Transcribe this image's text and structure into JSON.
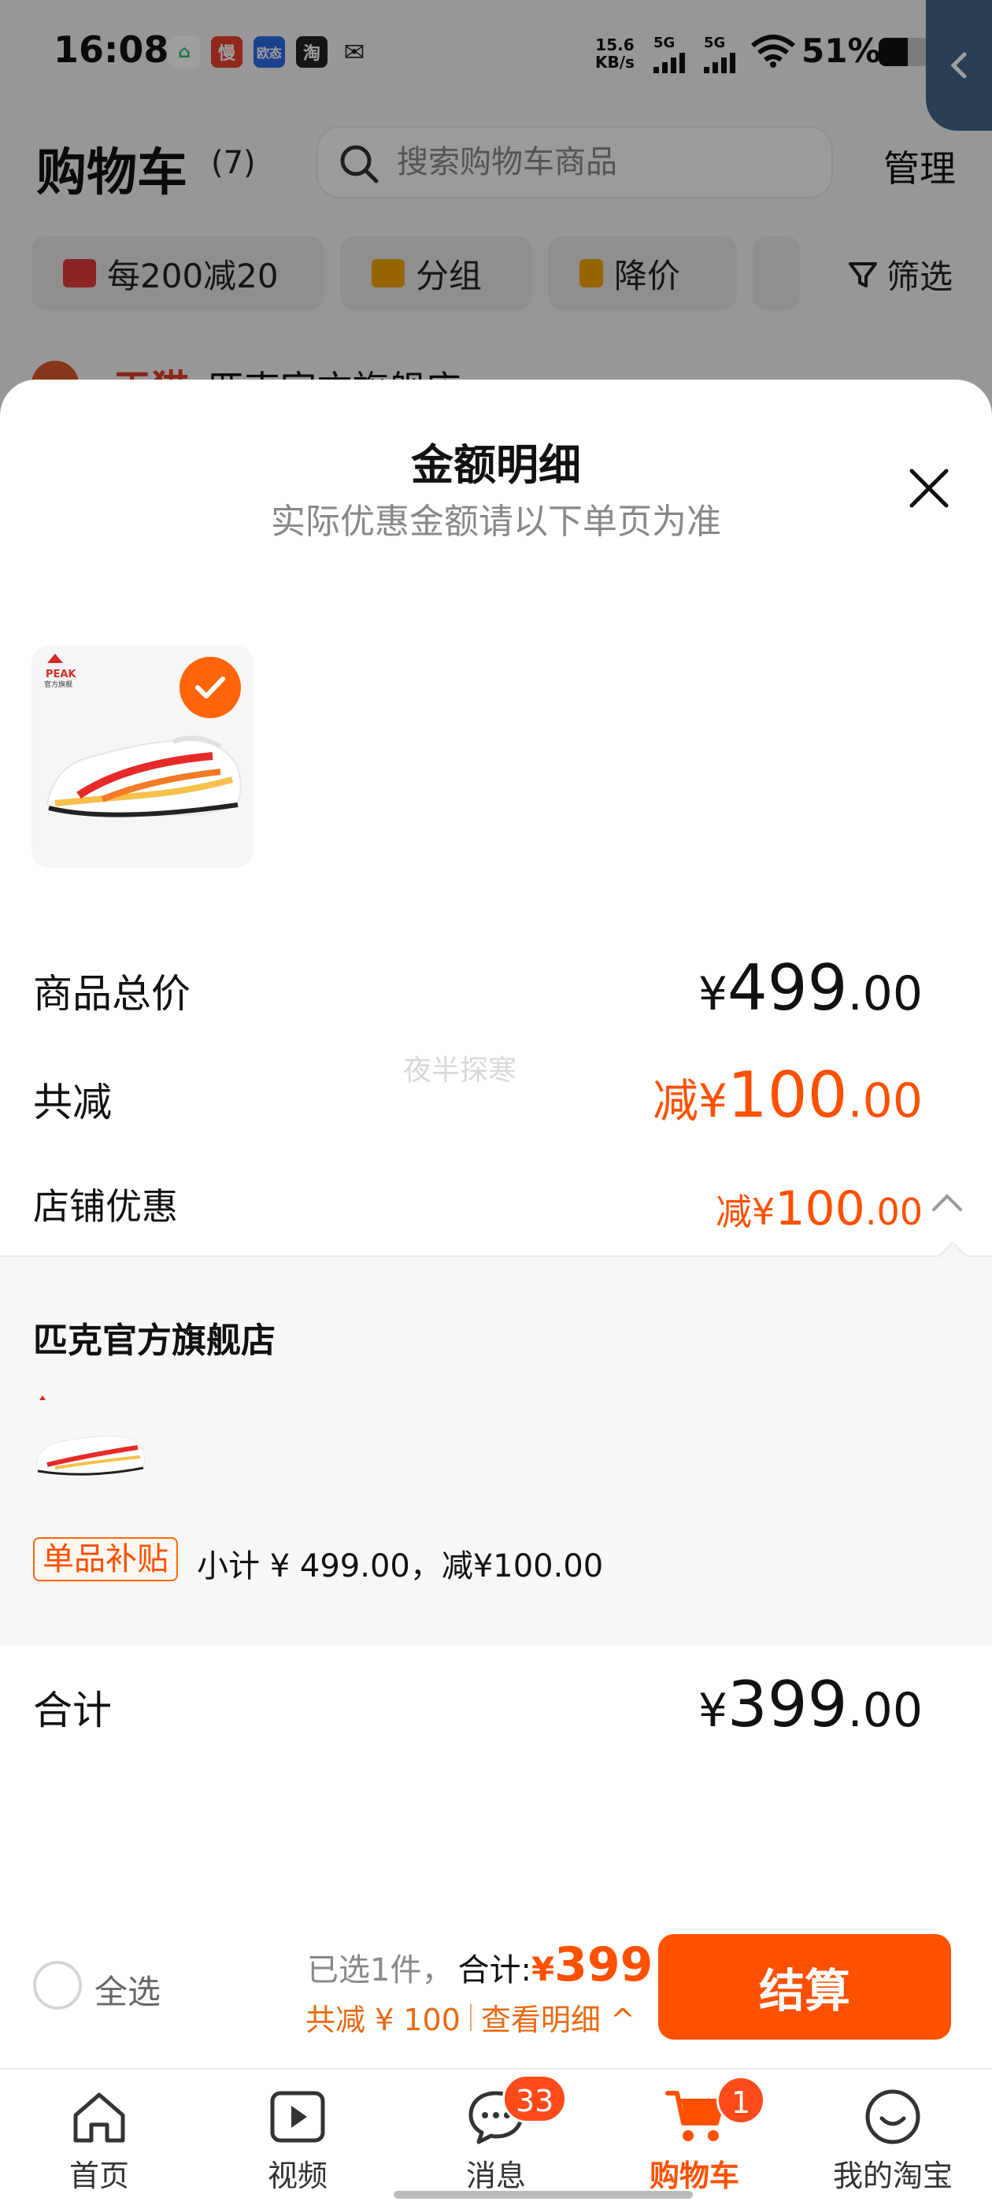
{
  "status_bar": {
    "time": "16:08",
    "app_icons": [
      {
        "name": "home-app-icon",
        "text": "⌂",
        "color": "#2dbd6e"
      },
      {
        "name": "manman-app-icon",
        "text": "慢",
        "color": "#e8412c"
      },
      {
        "name": "oumi-app-icon",
        "text": "欧态",
        "color": "#2e6be6"
      },
      {
        "name": "taobao-app-icon",
        "text": "淘",
        "color": "#222222"
      },
      {
        "name": "wechat-app-icon",
        "text": "✉",
        "color": "#222222"
      }
    ],
    "net_speed_value": "15.6",
    "net_speed_unit": "KB/s",
    "signal_1": "5G",
    "signal_2": "5G",
    "battery_percent": "51%",
    "battery_level": 0.51
  },
  "header": {
    "title": "购物车",
    "count": "(7)",
    "search_placeholder": "搜索购物车商品",
    "manage_label": "管理"
  },
  "filter_chips": [
    {
      "label": "每200减20",
      "icon": "store-icon",
      "icon_color": "#e03a3a"
    },
    {
      "label": "分组",
      "icon": "folder-icon",
      "icon_color": "#f0a500"
    },
    {
      "label": "降价",
      "icon": "price-drop-icon",
      "icon_color": "#f0a500"
    }
  ],
  "filter_label": "筛选",
  "store_peek": {
    "tmall": "天猫",
    "name": "匹克官方旗舰店 ›"
  },
  "sheet": {
    "title": "金额明细",
    "subtitle": "实际优惠金额请以下单页为准",
    "product_logo_text": "PEAK",
    "product_logo_sub": "官方旗舰",
    "rows": {
      "total": {
        "label": "商品总价",
        "currency": "¥",
        "int": "499",
        "dec": ".00"
      },
      "discount": {
        "label": "共减",
        "prefix": "减",
        "currency": "¥",
        "int": "100",
        "dec": ".00"
      },
      "shop_discount": {
        "label": "店铺优惠",
        "prefix": "减",
        "currency": "¥",
        "int": "100",
        "dec": ".00"
      },
      "sum": {
        "label": "合计",
        "currency": "¥",
        "int": "399",
        "dec": ".00"
      }
    },
    "watermark": "夜半探寒",
    "detail": {
      "shop_name": "匹克官方旗舰店",
      "tag": "单品补贴",
      "subtotal": "小计 ¥ 499.00，减¥100.00"
    }
  },
  "checkout": {
    "select_all": "全选",
    "selected": "已选1件，",
    "total_label": "合计:",
    "total_currency": "¥",
    "total_value": "399",
    "saved": "共减 ¥ 100",
    "view_detail": "查看明细 ^",
    "pay_label": "结算"
  },
  "tabs": [
    {
      "label": "首页",
      "icon": "home-icon"
    },
    {
      "label": "视频",
      "icon": "video-icon"
    },
    {
      "label": "消息",
      "icon": "message-icon",
      "badge": "33"
    },
    {
      "label": "购物车",
      "icon": "cart-icon",
      "badge": "1",
      "active": true
    },
    {
      "label": "我的淘宝",
      "icon": "profile-icon"
    }
  ],
  "colors": {
    "accent": "#ff5000",
    "accent_light": "#ff6508",
    "sheet_bg": "#ffffff",
    "detail_bg": "#f7f7f7"
  }
}
